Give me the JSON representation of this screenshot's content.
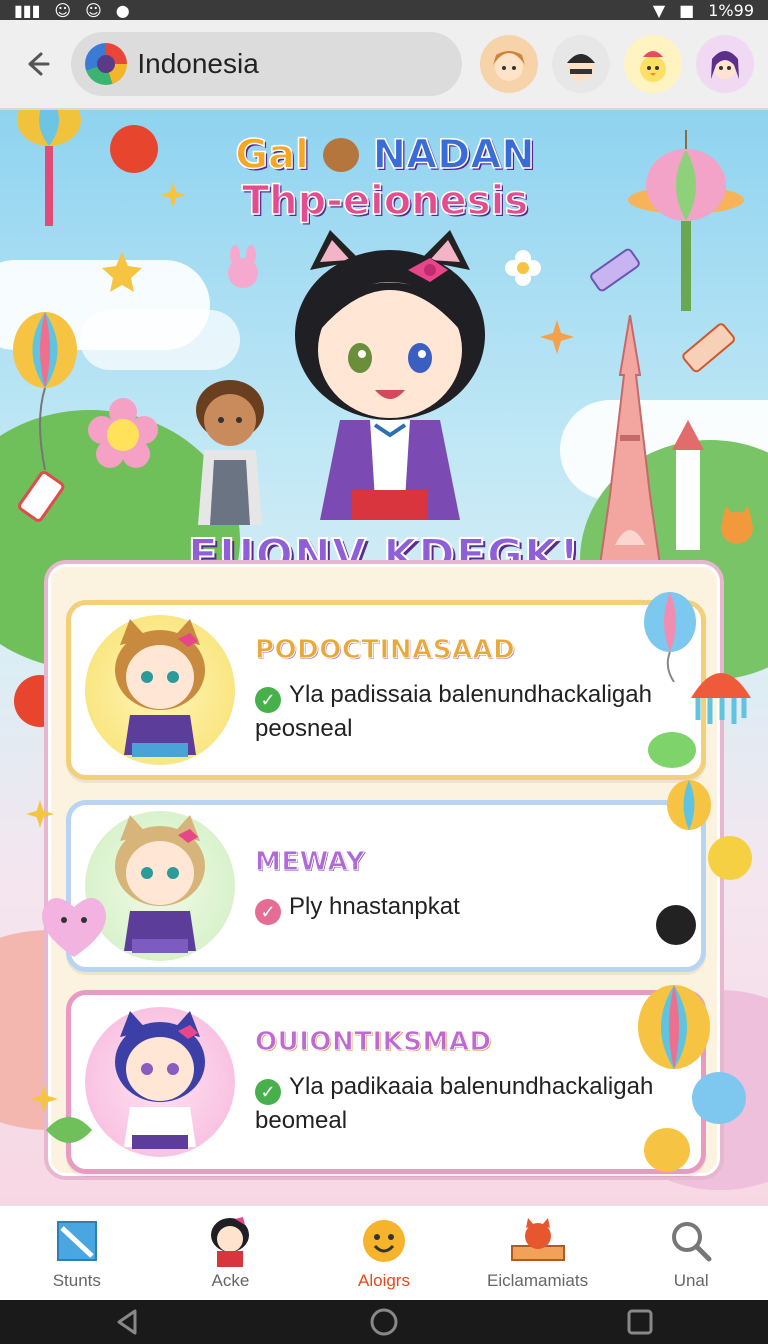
{
  "status_bar": {
    "battery": "1%99"
  },
  "header": {
    "search": {
      "value": "Indonesia",
      "icon": "globe-icon"
    },
    "avatars": [
      "avatar-girl-orange-hair",
      "avatar-boy-cap",
      "avatar-duck",
      "avatar-girl-purple-hair"
    ]
  },
  "hero": {
    "title_line1_prefix": "Gal",
    "title_line1_rest": "NADAN",
    "title_line2": "Thp-eionesis",
    "headline": "FUONV KDEGK!"
  },
  "cards": [
    {
      "title": "PODOCTINASAAD",
      "desc": "Yla padissaia balenundhackaligah peosneal",
      "check_color": "#47b04b"
    },
    {
      "title": "MEWAY",
      "desc": "Ply hnastanpkat",
      "check_color": "#e66b95"
    },
    {
      "title": "OUIONTIKSMAD",
      "desc": "Yla padikaaia balenundhackaligah beomeal",
      "check_color": "#47b04b"
    }
  ],
  "bottom_nav": {
    "items": [
      {
        "label": "Stunts",
        "icon": "flag-icon",
        "active": false
      },
      {
        "label": "Acke",
        "icon": "character-icon",
        "active": false
      },
      {
        "label": "Aloigrs",
        "icon": "smiley-icon",
        "active": true
      },
      {
        "label": "Eiclamamiats",
        "icon": "fox-board-icon",
        "active": false
      },
      {
        "label": "Unal",
        "icon": "search-icon",
        "active": false
      }
    ]
  },
  "colors": {
    "accent": "#e64a19",
    "panel_bg": "#fbf3df",
    "card1_border": "#f4cf7a",
    "card2_border": "#b9d3f2",
    "card3_border": "#e89ac2"
  }
}
